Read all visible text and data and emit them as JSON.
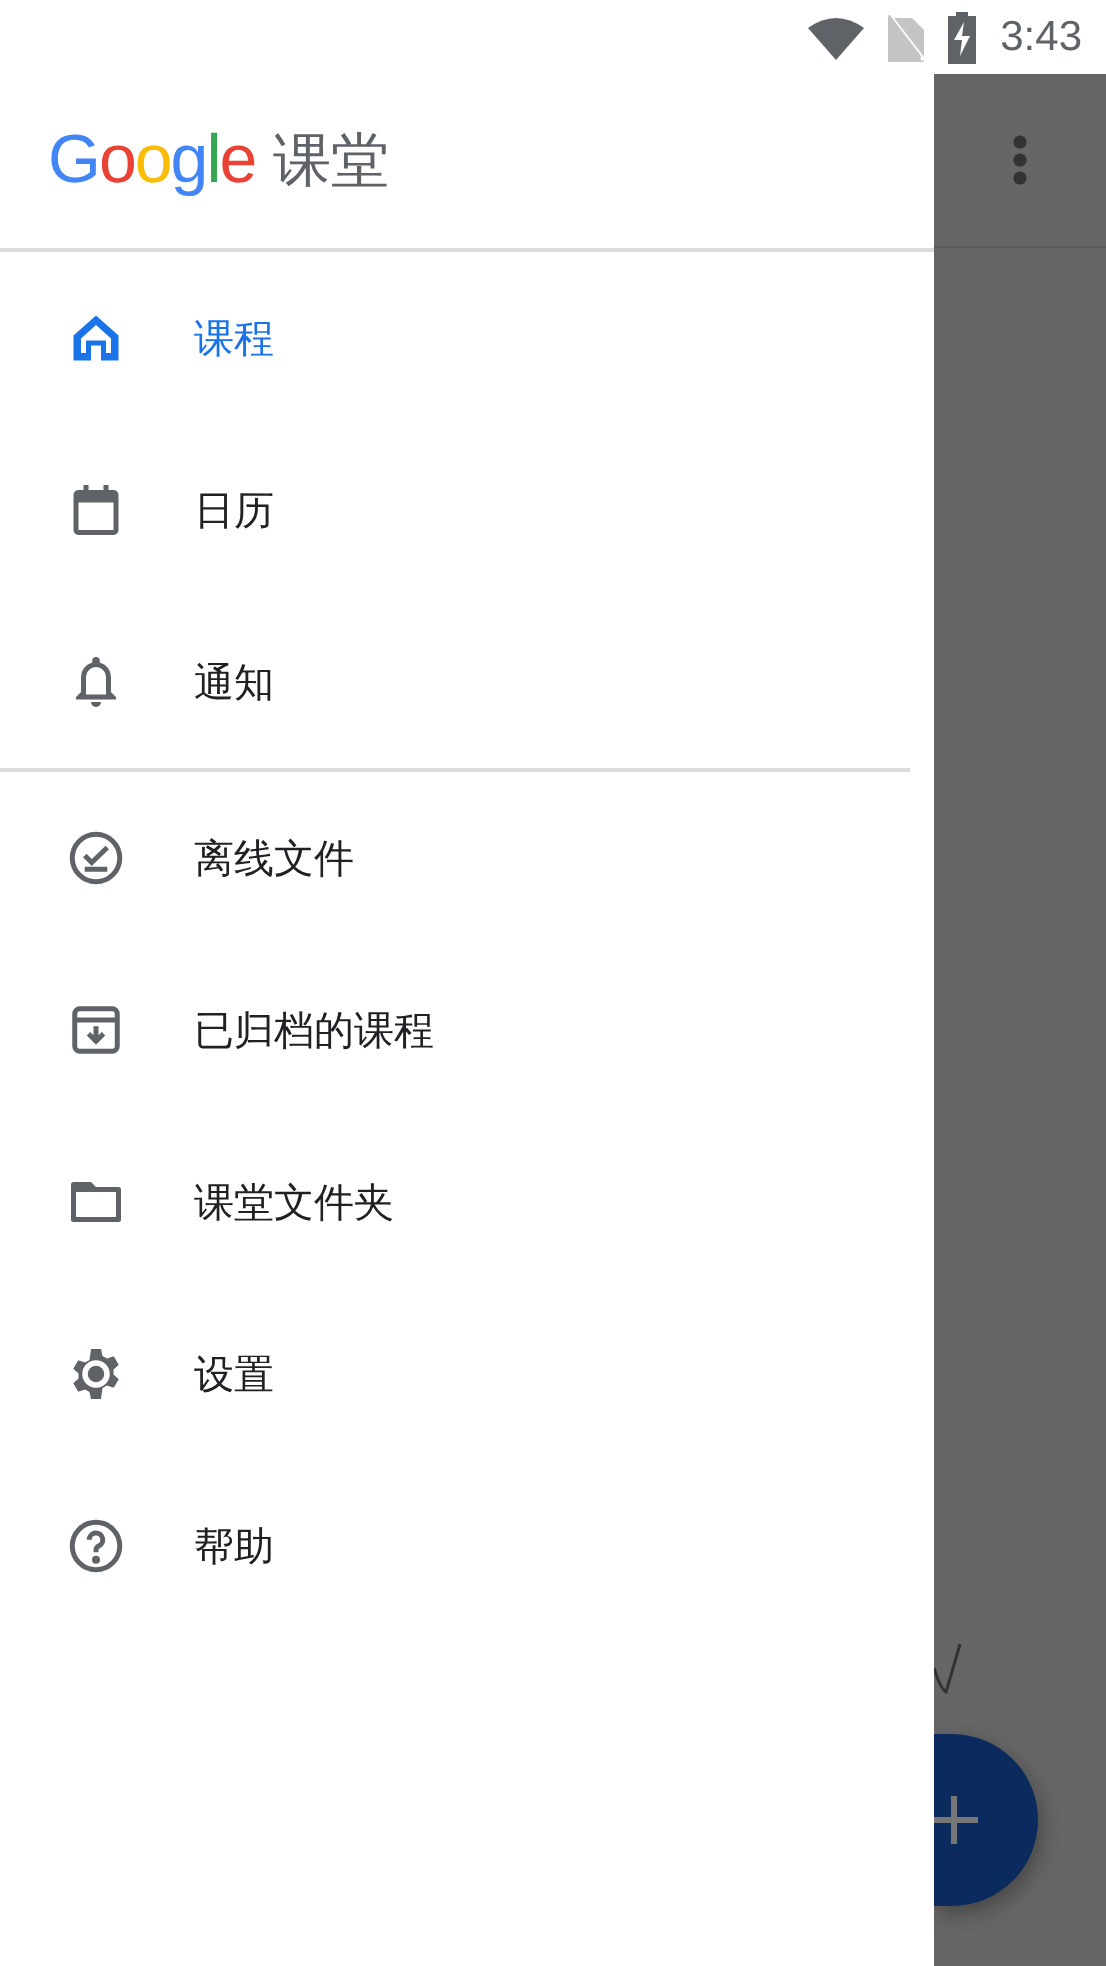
{
  "status_bar": {
    "time": "3:43"
  },
  "drawer": {
    "header": {
      "logo": "Google",
      "title": "课堂"
    },
    "sections": [
      {
        "items": [
          {
            "label": "课程",
            "selected": true
          },
          {
            "label": "日历",
            "selected": false
          },
          {
            "label": "通知",
            "selected": false
          }
        ]
      },
      {
        "items": [
          {
            "label": "离线文件",
            "selected": false
          },
          {
            "label": "已归档的课程",
            "selected": false
          },
          {
            "label": "课堂文件夹",
            "selected": false
          },
          {
            "label": "设置",
            "selected": false
          },
          {
            "label": "帮助",
            "selected": false
          }
        ]
      }
    ]
  }
}
